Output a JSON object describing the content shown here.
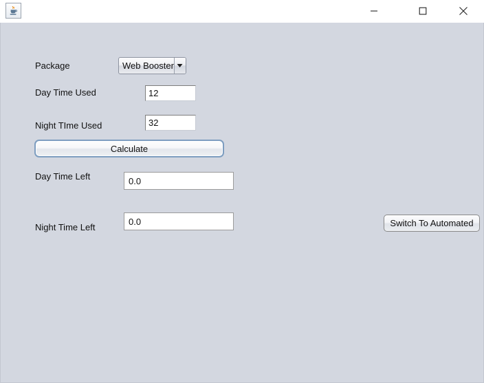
{
  "window": {
    "icon_name": "java-coffee-cup-icon",
    "title": "",
    "controls": {
      "minimize_label": "—",
      "maximize_label": "□",
      "close_label": "✕"
    }
  },
  "form": {
    "package": {
      "label": "Package",
      "selected": "Web Booster",
      "arrow_icon": "chevron-down-icon"
    },
    "day_time_used": {
      "label": "Day Time Used",
      "value": "12",
      "placeholder": ""
    },
    "night_time_used": {
      "label": "Night TIme Used",
      "value": "32",
      "placeholder": ""
    },
    "day_time_left": {
      "label": "Day Time Left",
      "value": "0.0"
    },
    "night_time_left": {
      "label": "Night Time Left",
      "value": "0.0"
    }
  },
  "actions": {
    "calculate_label": "Calculate",
    "switch_to_automated_label": "Switch To Automated"
  },
  "colors": {
    "panel_background": "#d3d7e0",
    "title_bar_background": "#ffffff",
    "focus_border": "#7d9dc0",
    "field_border": "#7d7d7d",
    "text": "#101010"
  }
}
